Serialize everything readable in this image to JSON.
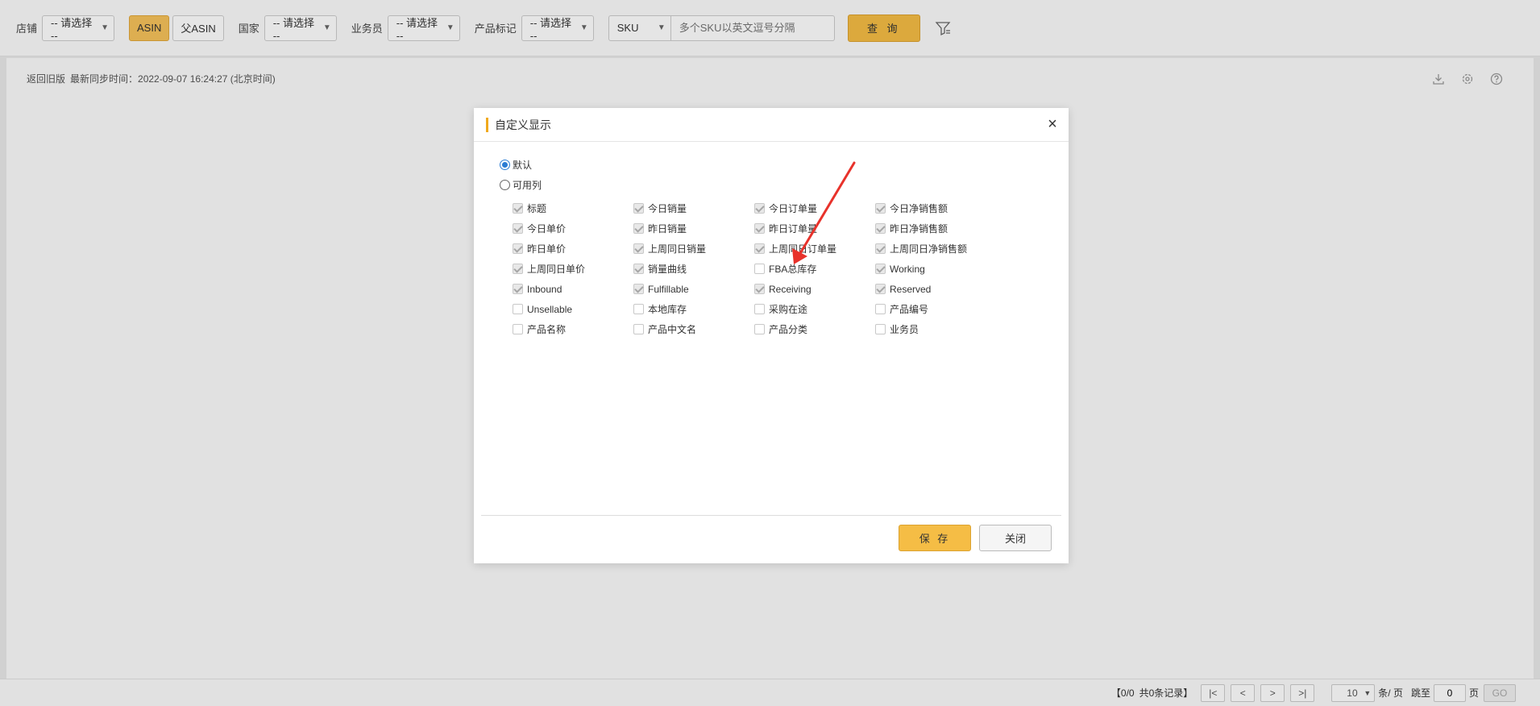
{
  "filters": {
    "shop_label": "店铺",
    "shop_select": "-- 请选择 --",
    "asin_tabs": [
      "ASIN",
      "父ASIN"
    ],
    "country_label": "国家",
    "country_select": "-- 请选择 --",
    "salesman_label": "业务员",
    "salesman_select": "-- 请选择 --",
    "tag_label": "产品标记",
    "tag_select": "-- 请选择 --",
    "sku_type": "SKU",
    "sku_placeholder": "多个SKU以英文逗号分隔",
    "query_label": "查 询"
  },
  "status": {
    "back_link": "返回旧版",
    "sync_text": "最新同步时间：2022-09-07 16:24:27 (北京时间)"
  },
  "modal": {
    "title": "自定义显示",
    "radio_default": "默认",
    "radio_columns": "可用列",
    "columns": [
      {
        "label": "标题",
        "checked": true
      },
      {
        "label": "今日销量",
        "checked": true
      },
      {
        "label": "今日订单量",
        "checked": true
      },
      {
        "label": "今日净销售额",
        "checked": true
      },
      {
        "label": "今日单价",
        "checked": true
      },
      {
        "label": "昨日销量",
        "checked": true
      },
      {
        "label": "昨日订单量",
        "checked": true
      },
      {
        "label": "昨日净销售额",
        "checked": true
      },
      {
        "label": "昨日单价",
        "checked": true
      },
      {
        "label": "上周同日销量",
        "checked": true
      },
      {
        "label": "上周同日订单量",
        "checked": true
      },
      {
        "label": "上周同日净销售额",
        "checked": true
      },
      {
        "label": "上周同日单价",
        "checked": true
      },
      {
        "label": "销量曲线",
        "checked": true
      },
      {
        "label": "FBA总库存",
        "checked": false
      },
      {
        "label": "Working",
        "checked": true
      },
      {
        "label": "Inbound",
        "checked": true
      },
      {
        "label": "Fulfillable",
        "checked": true
      },
      {
        "label": "Receiving",
        "checked": true
      },
      {
        "label": "Reserved",
        "checked": true
      },
      {
        "label": "Unsellable",
        "checked": false
      },
      {
        "label": "本地库存",
        "checked": false
      },
      {
        "label": "采购在途",
        "checked": false
      },
      {
        "label": "产品编号",
        "checked": false
      },
      {
        "label": "产品名称",
        "checked": false
      },
      {
        "label": "产品中文名",
        "checked": false
      },
      {
        "label": "产品分类",
        "checked": false
      },
      {
        "label": "业务员",
        "checked": false
      }
    ],
    "save_label": "保 存",
    "close_label": "关闭"
  },
  "pagination": {
    "summary": "【0/0",
    "total": "共0条记录】",
    "page_size": "10",
    "per_page_label": "条/ 页",
    "jump_label": "跳至",
    "page_input": "0",
    "page_label": "页",
    "go_label": "GO"
  },
  "colors": {
    "accent": "#f5bd45",
    "arrow": "#e8322b",
    "radio": "#2b7cd3"
  }
}
